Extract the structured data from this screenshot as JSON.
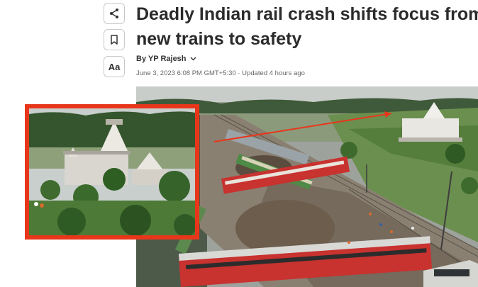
{
  "article": {
    "headline_line1": "Deadly Indian rail crash shifts focus from",
    "headline_line2": "new trains to safety",
    "author": "By YP Rajesh",
    "timestamp": "June 3, 2023 6:08 PM GMT+5:30 · Updated 4 hours ago"
  },
  "toolbar": {
    "text_size_label": "Aa",
    "icons": [
      "share-icon",
      "bookmark-icon",
      "text-size-icon"
    ]
  },
  "colors": {
    "headline": "#2b2b2b",
    "highlight_border": "#e8361b",
    "train_red": "#c8322f",
    "pointer_line": "#e8361b"
  }
}
